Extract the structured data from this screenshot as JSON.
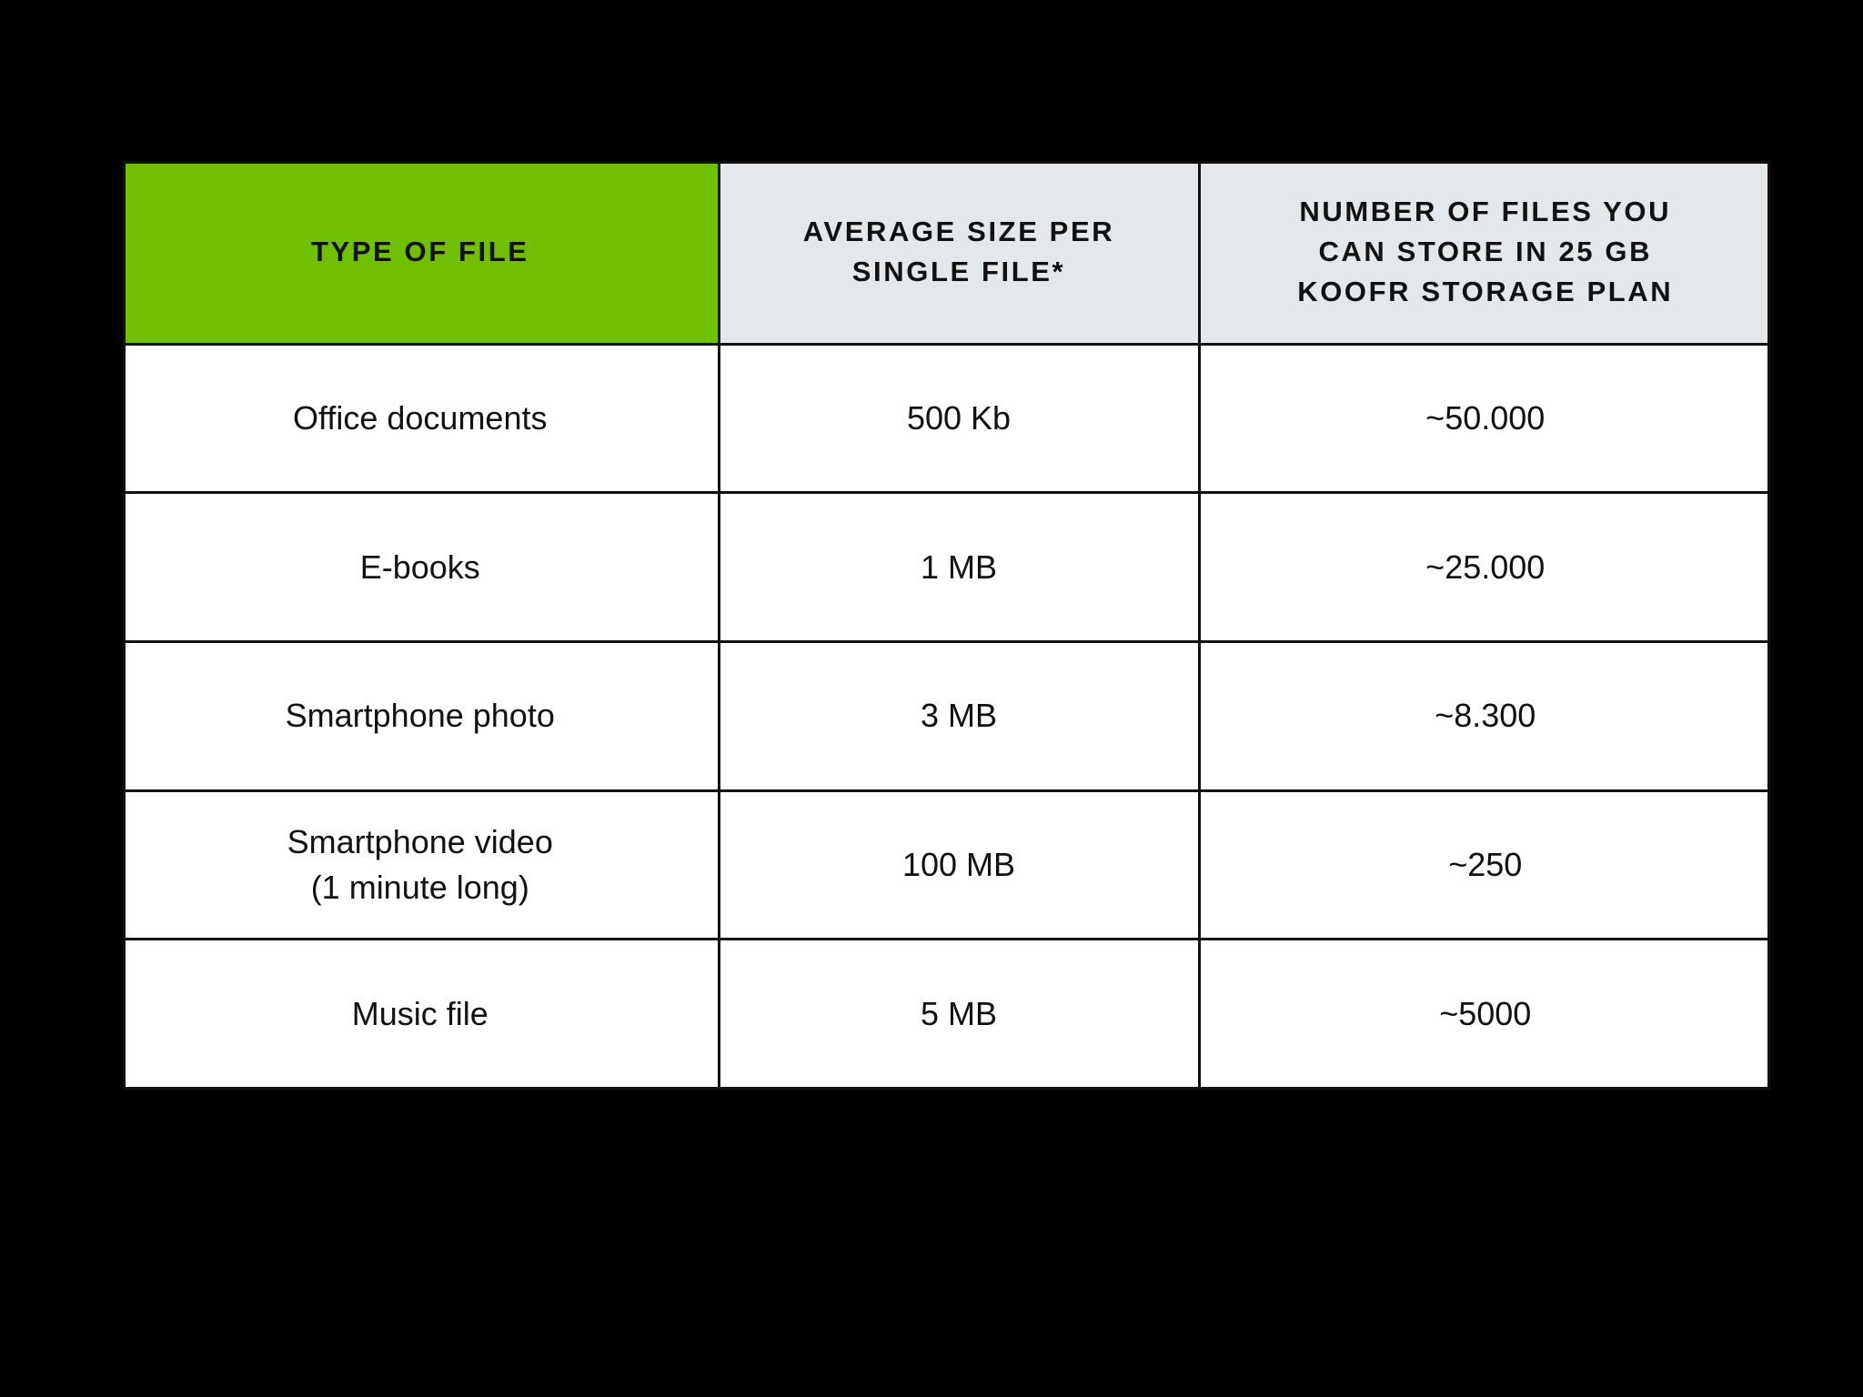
{
  "theme": {
    "page_background": "#000000",
    "table_background": "#ffffff",
    "header_accent_green": "#70BF00",
    "header_grey": "#e4e8ea",
    "rule_color": "#111111",
    "text_color": "#111111"
  },
  "table": {
    "headers": [
      {
        "key": "type_of_file",
        "lines": [
          "TYPE OF FILE"
        ],
        "background": "#70BF00"
      },
      {
        "key": "average_size",
        "lines": [
          "AVERAGE SIZE PER",
          "SINGLE FILE*"
        ],
        "background": "#e4e8ea"
      },
      {
        "key": "number_of_files",
        "lines": [
          "NUMBER OF FILES YOU",
          "CAN STORE IN 25 GB",
          "KOOFR STORAGE PLAN"
        ],
        "background": "#e4e8ea"
      }
    ],
    "rows": [
      {
        "type_lines": [
          "Office documents"
        ],
        "average_size": "500 Kb",
        "number_of_files": "~50.000"
      },
      {
        "type_lines": [
          "E-books"
        ],
        "average_size": "1 MB",
        "number_of_files": "~25.000"
      },
      {
        "type_lines": [
          "Smartphone photo"
        ],
        "average_size": "3 MB",
        "number_of_files": "~8.300"
      },
      {
        "type_lines": [
          "Smartphone video",
          "(1 minute long)"
        ],
        "average_size": "100 MB",
        "number_of_files": "~250"
      },
      {
        "type_lines": [
          "Music file"
        ],
        "average_size": "5 MB",
        "number_of_files": "~5000"
      }
    ]
  }
}
